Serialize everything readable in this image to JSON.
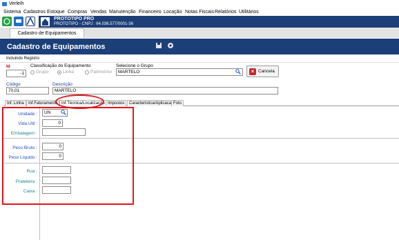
{
  "window": {
    "title": "Verleih"
  },
  "menu": [
    "Sistema",
    "Cadastros",
    "Estoque",
    "Compras",
    "Vendas",
    "Manutenção",
    "Financeiro",
    "Locação",
    "Notas Fiscais",
    "Relatórios",
    "Utilitários"
  ],
  "brand": {
    "name": "PROTOTIPO PRO",
    "cnpj": "PROTOTIPO - CNPJ : 64.036.577/0001-36"
  },
  "doc_tab": "Cadastro de Equipamentos",
  "header": {
    "title": "Cadastro de Equipamentos"
  },
  "status": "Incluindo Registro",
  "form": {
    "id_label": "Id",
    "id_value": "-1",
    "classificacao_label": "Classificação do Equipamento",
    "classificacao_options": [
      "Grupo",
      "Linha",
      "Patrimônio"
    ],
    "classificacao_selected": "Linha",
    "grupo_label": "Selecione o Grupo",
    "grupo_value": "MARTELO",
    "cancel_label": "Cancela",
    "codigo_label": "Código",
    "codigo_value": "70,01",
    "descricao_label": "Descrição",
    "descricao_value": "MARTELO"
  },
  "tabs": [
    "Inf. Linha",
    "Inf.Faturamento",
    "Inf.Técnica/Localização",
    "Impostos",
    "Caracteristica/Aplicacao",
    "Foto"
  ],
  "active_tab": "Inf.Técnica/Localização",
  "tecnica": {
    "unidade_label": "Unidade :",
    "unidade_value": "UN",
    "vida_util_label": "Vida Util :",
    "vida_util_value": "0",
    "embalagem_label": "Embalagem :",
    "embalagem_value": "",
    "peso_bruto_label": "Peso Bruto :",
    "peso_bruto_value": "0",
    "peso_liquido_label": "Peso Líquido :",
    "peso_liquido_value": "0",
    "rua_label": "Rua :",
    "rua_value": "",
    "prateleira_label": "Prateleira :",
    "prateleira_value": "",
    "caixa_label": "Caixa :",
    "caixa_value": ""
  },
  "colors": {
    "navy": "#1c3f78",
    "annotation_red": "#e0141a",
    "label_blue": "#1d4fc2",
    "label_teal": "#1b8a8a"
  },
  "icons": [
    "app-icon",
    "whatsapp-icon",
    "chat-icon",
    "logo-icon",
    "home-icon",
    "save-icon",
    "refresh-icon",
    "search-icon",
    "close-icon"
  ]
}
